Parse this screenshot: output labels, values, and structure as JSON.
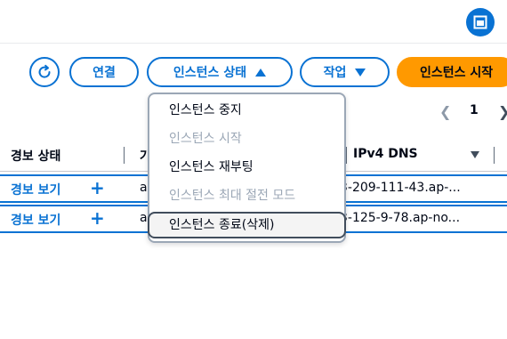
{
  "toolbar": {
    "connect_label": "연결",
    "instance_state_label": "인스턴스 상태",
    "actions_label": "작업",
    "launch_label": "인스턴스 시작"
  },
  "pagination": {
    "current_page": "1"
  },
  "table": {
    "headers": {
      "alarm_status": "경보 상태",
      "col2_partial": "가",
      "ipv4_dns": "IPv4 DNS"
    },
    "rows": [
      {
        "alarm_link": "경보 보기",
        "plus": "+",
        "col2": "a",
        "dns": "3-209-111-43.ap-..."
      },
      {
        "alarm_link": "경보 보기",
        "plus": "+",
        "col2": "a",
        "dns": "3-125-9-78.ap-no..."
      }
    ]
  },
  "state_menu": {
    "items": [
      {
        "label": "인스턴스 중지",
        "disabled": false
      },
      {
        "label": "인스턴스 시작",
        "disabled": true
      },
      {
        "label": "인스턴스 재부팅",
        "disabled": false
      },
      {
        "label": "인스턴스 최대 절전 모드",
        "disabled": true
      },
      {
        "label": "인스턴스 종료(삭제)",
        "disabled": false,
        "highlighted": true
      }
    ]
  },
  "colors": {
    "accent": "#0972d3",
    "primary_button": "#ff9900",
    "disabled_text": "#9ba7b6"
  }
}
